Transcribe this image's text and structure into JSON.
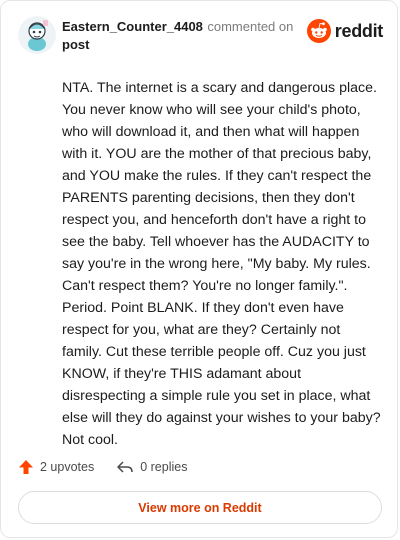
{
  "header": {
    "username": "Eastern_Counter_4408",
    "commented_text": "commented on",
    "post_link": "post",
    "brand": "reddit",
    "brand_color": "#ff4500",
    "avatar_icon": "snoo-avatar-icon"
  },
  "comment": {
    "text": "NTA. The internet is a scary and dangerous place. You never know who will see your child's photo, who will download it, and then what will happen with it. YOU are the mother of that precious baby, and YOU make the rules. If they can't respect the PARENTS parenting decisions, then they don't respect you, and henceforth don't have a right to see the baby. Tell whoever has the AUDACITY to say you're in the wrong here, \"My baby. My rules. Can't respect them? You're no longer family.\". Period. Point BLANK. If they don't even have respect for you, what are they? Certainly not family. Cut these terrible people off. Cuz you just KNOW, if they're THIS adamant about disrespecting a simple rule you set in place, what else will they do against your wishes to your baby? Not cool."
  },
  "actions": {
    "upvotes": "2 upvotes",
    "upvote_icon": "upvote-arrow-icon",
    "upvote_color": "#ff4500",
    "replies": "0 replies",
    "reply_icon": "reply-arrow-icon"
  },
  "footer": {
    "view_more": "View more on Reddit",
    "view_more_color": "#d93a00"
  }
}
